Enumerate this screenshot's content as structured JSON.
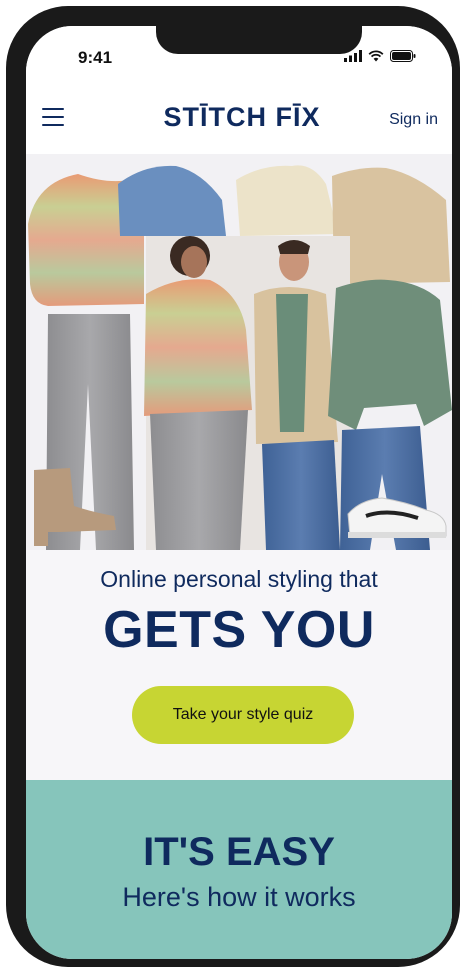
{
  "status_bar": {
    "time": "9:41"
  },
  "nav": {
    "logo": "STĪTCH FĪX",
    "sign_in": "Sign in"
  },
  "hero": {
    "tagline": "Online personal styling that",
    "headline": "GETS YOU",
    "cta_label": "Take your style quiz"
  },
  "easy_section": {
    "title": "IT'S EASY",
    "subtitle": "Here's how it works"
  },
  "colors": {
    "brand_navy": "#0f2a5e",
    "cta_lime": "#c7d533",
    "easy_teal": "#86c5bb"
  }
}
